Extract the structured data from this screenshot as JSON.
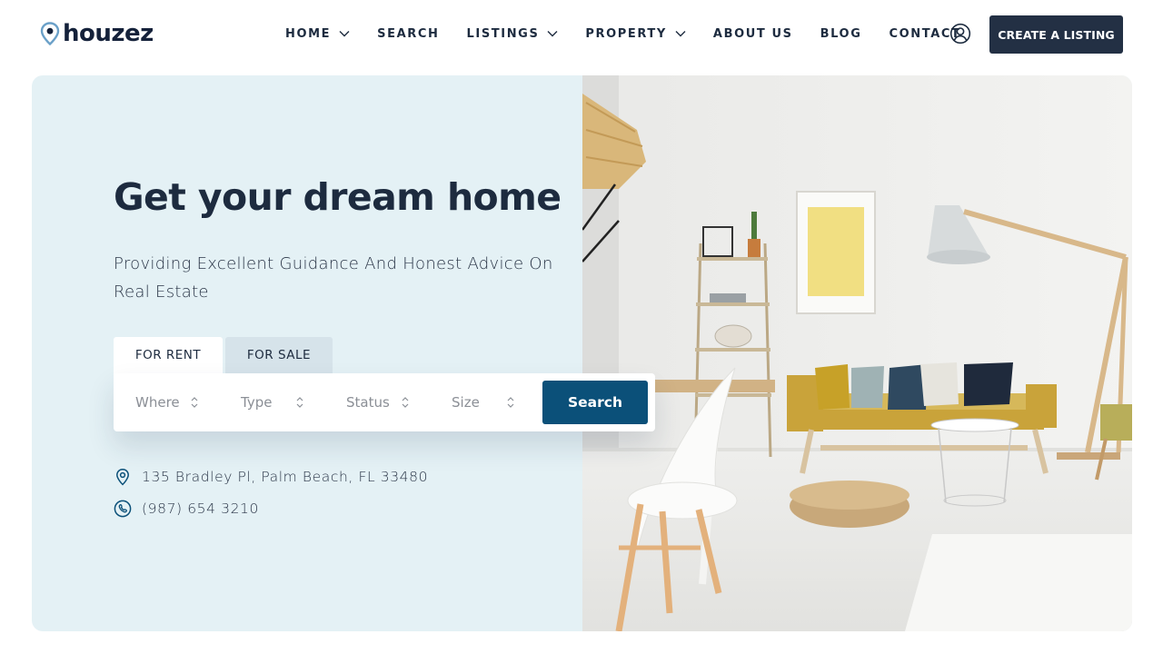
{
  "brand": {
    "name": "houzez",
    "accent": "#6aa0c8"
  },
  "nav": {
    "items": [
      {
        "label": "HOME",
        "has_dropdown": true
      },
      {
        "label": "SEARCH",
        "has_dropdown": false
      },
      {
        "label": "LISTINGS",
        "has_dropdown": true
      },
      {
        "label": "PROPERTY",
        "has_dropdown": true
      },
      {
        "label": "ABOUT US",
        "has_dropdown": false
      },
      {
        "label": "BLOG",
        "has_dropdown": false
      },
      {
        "label": "CONTACT",
        "has_dropdown": false
      }
    ],
    "user_icon": "user-circle-icon",
    "cta_label": "CREATE A LISTING"
  },
  "hero": {
    "headline": "Get your dream home",
    "subtitle": "Providing Excellent Guidance And Honest Advice On Real Estate",
    "tabs": [
      {
        "label": "FOR RENT",
        "active": true
      },
      {
        "label": "FOR SALE",
        "active": false
      }
    ],
    "search": {
      "fields": [
        {
          "label": "Where"
        },
        {
          "label": "Type"
        },
        {
          "label": "Status"
        },
        {
          "label": "Size"
        }
      ],
      "button_label": "Search"
    },
    "contact": {
      "address": "135 Bradley Pl, Palm Beach, FL 33480",
      "phone": "(987) 654 3210"
    }
  },
  "colors": {
    "dark": "#233044",
    "primary_button": "#0b5079",
    "hero_bg": "#e4f1f5",
    "text": "#1d2b3f"
  }
}
